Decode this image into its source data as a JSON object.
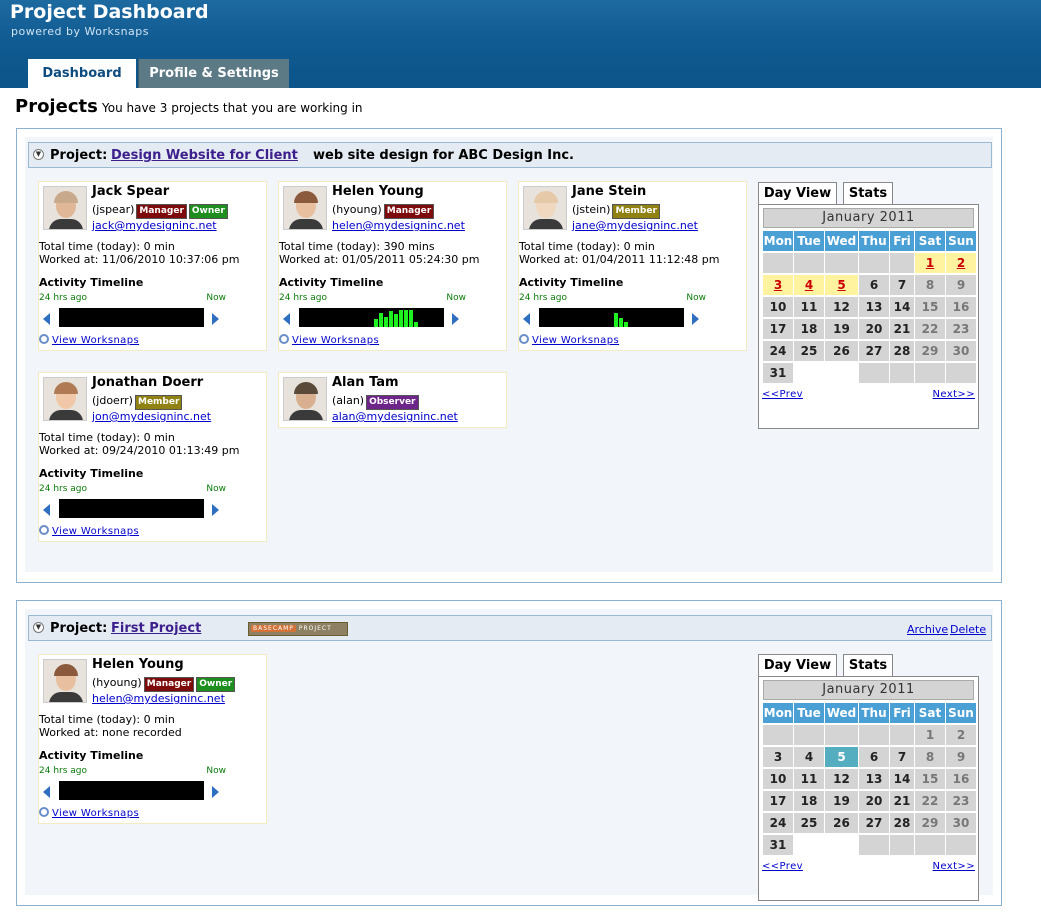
{
  "header": {
    "title": "Project Dashboard",
    "subtitle": "powered by Worksnaps"
  },
  "tabs": [
    {
      "label": "Dashboard"
    },
    {
      "label": "Profile & Settings"
    }
  ],
  "page": {
    "title": "Projects",
    "subtitle": "You have 3 projects that you are working in"
  },
  "colors": {
    "header": "#0f5a91",
    "accent": "#4a9fd4",
    "timeline_bar": "#1ff01f"
  },
  "common": {
    "total_prefix": "Total time (today): ",
    "worked_prefix": "Worked at: ",
    "activity": "Activity Timeline",
    "h24": "24 hrs ago",
    "now": "Now",
    "view": "View Worksnaps",
    "prev": "<<Prev",
    "next": "Next>>",
    "day_view": "Day View",
    "stats": "Stats",
    "month": "January 2011",
    "days": [
      "Mon",
      "Tue",
      "Wed",
      "Thu",
      "Fri",
      "Sat",
      "Sun"
    ]
  },
  "projects": [
    {
      "label": "Project:",
      "name": "Design Website for Client",
      "desc": "web site design for ABC Design Inc.",
      "members": [
        {
          "name": "Jack Spear",
          "user": "(jspear)",
          "roles": [
            "Manager",
            "Owner"
          ],
          "email": "jack@mydesigninc.net",
          "total": "Total time (today): 0 min",
          "worked": "Worked at: 11/06/2010 10:37:06 pm",
          "activity": []
        },
        {
          "name": "Helen Young",
          "user": "(hyoung)",
          "roles": [
            "Manager"
          ],
          "email": "helen@mydesigninc.net",
          "total": "Total time (today): 390 mins",
          "worked": "Worked at: 01/05/2011 05:24:30 pm",
          "activity": [
            0.45,
            0.75,
            0.55,
            0.9,
            0.7,
            0.95,
            0.95,
            0.95,
            0.25
          ]
        },
        {
          "name": "Jane Stein",
          "user": "(jstein)",
          "roles": [
            "Member"
          ],
          "email": "jane@mydesigninc.net",
          "total": "Total time (today): 0 min",
          "worked": "Worked at: 01/04/2011 11:12:48 pm",
          "activity": [
            0.8,
            0.5,
            0.25
          ]
        },
        {
          "name": "Jonathan Doerr",
          "user": "(jdoerr)",
          "roles": [
            "Member"
          ],
          "email": "jon@mydesigninc.net",
          "total": "Total time (today): 0 min",
          "worked": "Worked at: 09/24/2010 01:13:49 pm",
          "activity": []
        },
        {
          "name": "Alan Tam",
          "user": "(alan)",
          "roles": [
            "Observer"
          ],
          "email": "alan@mydesigninc.net"
        }
      ],
      "calendar": {
        "highlight": [
          1,
          2,
          3,
          4,
          5
        ],
        "today": null
      }
    },
    {
      "label": "Project:",
      "name": "First Project",
      "badge": "BASECAMP PROJECT",
      "archive": "Archive",
      "delete": "Delete",
      "members": [
        {
          "name": "Helen Young",
          "user": "(hyoung)",
          "roles": [
            "Manager",
            "Owner"
          ],
          "email": "helen@mydesigninc.net",
          "total": "Total time (today): 0 min",
          "worked": "Worked at: none recorded",
          "activity": []
        }
      ],
      "calendar": {
        "highlight": [],
        "today": 5
      }
    }
  ]
}
